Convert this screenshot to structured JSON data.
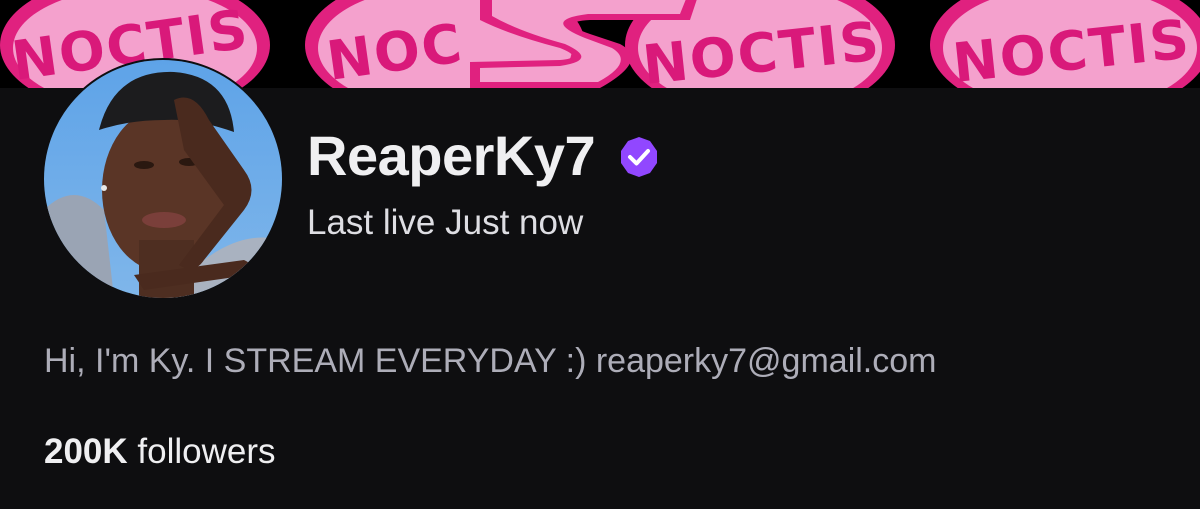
{
  "banner": {
    "text": "NOCTIS",
    "icon": "noctis-banner-art"
  },
  "channel": {
    "name": "ReaperKy7",
    "verified_icon": "verified-badge-icon",
    "verified_color": "#9147ff",
    "last_live": "Last live Just now"
  },
  "about": {
    "bio": "Hi, I'm Ky. I STREAM EVERYDAY :) reaperky7@gmail.com",
    "followers_count": "200K",
    "followers_label": "followers"
  }
}
